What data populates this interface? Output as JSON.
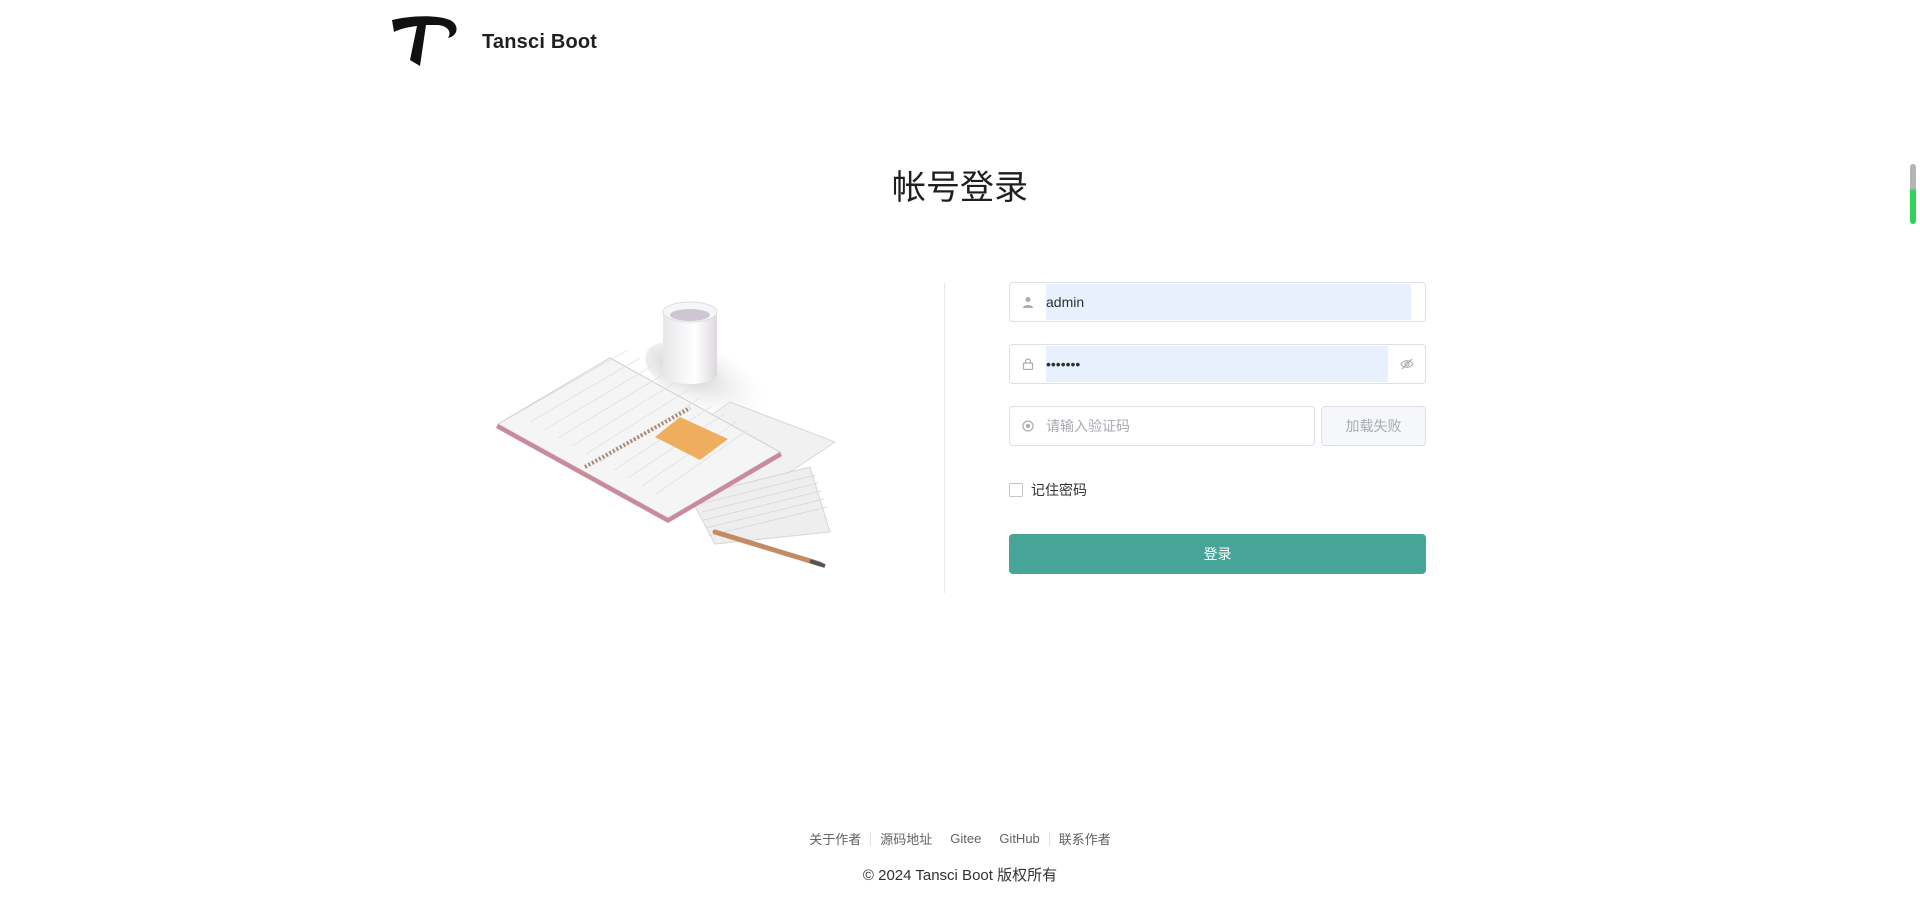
{
  "header": {
    "brand": "Tansci Boot"
  },
  "page_title": "帐号登录",
  "form": {
    "username": {
      "value": "admin",
      "icon": "user-icon"
    },
    "password": {
      "value": "•••••••",
      "icon": "lock-icon",
      "suffix_icon": "eye-off-icon"
    },
    "captcha": {
      "placeholder": "请输入验证码",
      "icon": "captcha-icon",
      "image_status": "加载失败"
    },
    "remember_label": "记住密码",
    "login_label": "登录"
  },
  "footer": {
    "links": [
      "关于作者",
      "源码地址",
      "Gitee",
      "GitHub",
      "联系作者"
    ],
    "copyright": "© 2024 Tansci Boot 版权所有"
  },
  "colors": {
    "primary": "#46a596",
    "autofill": "#e8f0fe"
  }
}
